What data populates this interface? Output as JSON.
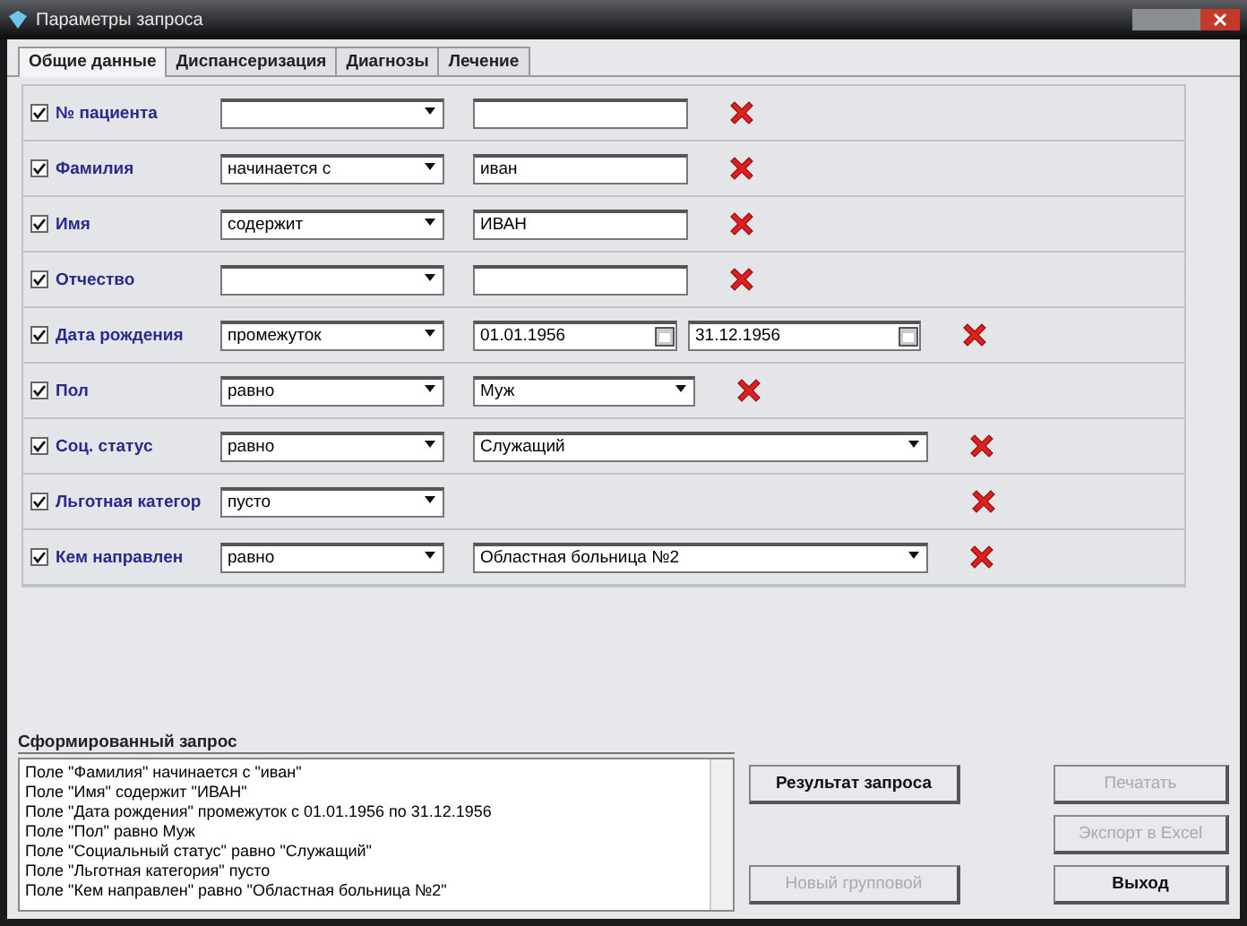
{
  "window": {
    "title": "Параметры запроса"
  },
  "tabs": [
    {
      "label": "Общие данные",
      "selected": true
    },
    {
      "label": "Диспансеризация",
      "selected": false
    },
    {
      "label": "Диагнозы",
      "selected": false
    },
    {
      "label": "Лечение",
      "selected": false
    }
  ],
  "criteria": [
    {
      "kind": "text",
      "checked": true,
      "label": "№ пациента"
    },
    {
      "kind": "text",
      "checked": true,
      "label": "Фамилия",
      "operator": "начинается с",
      "value": "иван"
    },
    {
      "kind": "text",
      "checked": true,
      "label": "Имя",
      "operator": "содержит",
      "value": "ИВАН"
    },
    {
      "kind": "text",
      "checked": true,
      "label": "Отчество"
    },
    {
      "kind": "date",
      "checked": true,
      "label": "Дата рождения",
      "operator": "промежуток",
      "value": "01.01.1956",
      "value_to": "31.12.1956"
    },
    {
      "kind": "combo",
      "checked": true,
      "label": "Пол",
      "operator": "равно",
      "value": "Муж"
    },
    {
      "kind": "wide",
      "checked": true,
      "label": "Соц. статус",
      "operator": "равно",
      "value": "Служащий"
    },
    {
      "kind": "none",
      "checked": true,
      "label": "Льготная категор",
      "operator": "пусто"
    },
    {
      "kind": "wide",
      "checked": true,
      "label": "Кем направлен",
      "operator": "равно",
      "value": "Областная больница №2"
    }
  ],
  "query": {
    "title": "Сформированный запрос",
    "lines": [
      "Поле \"Фамилия\"  начинается с  \"иван\"",
      "Поле \"Имя\"  содержит \"ИВАН\"",
      "Поле \"Дата рождения\"  промежуток с 01.01.1956 по 31.12.1956",
      "Поле \"Пол\"  равно Муж",
      "Поле \"Социальный статус\"  равно \"Служащий\"",
      "Поле \"Льготная категория\"  пусто",
      "Поле \"Кем направлен\"  равно \"Областная больница №2\""
    ]
  },
  "buttons": [
    {
      "label": "Результат запроса",
      "disabled": false
    },
    {
      "label": "Новый групповой",
      "disabled": true
    },
    {
      "label": "Печатать",
      "disabled": true
    },
    {
      "label": "Экспорт в Excel",
      "disabled": true
    },
    {
      "label": "Выход",
      "disabled": false
    }
  ]
}
